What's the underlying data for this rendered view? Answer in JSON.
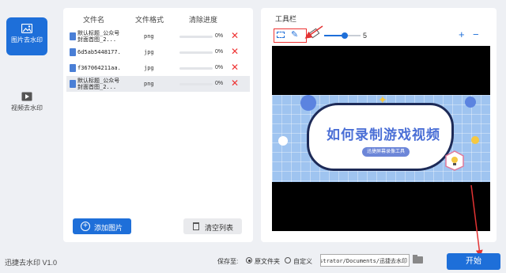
{
  "sidebar": {
    "items": [
      {
        "label": "图片去水印",
        "active": true
      },
      {
        "label": "视频去水印",
        "active": false
      }
    ]
  },
  "file_list": {
    "columns": [
      "文件名",
      "文件格式",
      "清除进度"
    ],
    "rows": [
      {
        "name": "默认标题_公众号封面首图_2...",
        "format": "png",
        "progress": "0%"
      },
      {
        "name": "6d5ab5448177...",
        "format": "jpg",
        "progress": "0%"
      },
      {
        "name": "f367064211aa...",
        "format": "jpg",
        "progress": "0%"
      },
      {
        "name": "默认标题_公众号封面首图_2...",
        "format": "png",
        "progress": "0%"
      }
    ],
    "add_button": "添加图片",
    "clear_button": "清空列表"
  },
  "toolbar": {
    "title": "工具栏",
    "brush_size": "5",
    "zoom_in": "+",
    "zoom_out": "−"
  },
  "preview": {
    "title_text": "如何录制游戏视频",
    "subtitle_text": "迅捷屏幕录像工具"
  },
  "footer": {
    "version": "迅捷去水印 V1.0",
    "save_label": "保存至:",
    "option_original": "原文件夹",
    "option_custom": "自定义",
    "path": "istrator/Documents/迅捷去水印",
    "start_button": "开始"
  },
  "colors": {
    "accent": "#1e6fd9",
    "delete": "#e33333",
    "annotation": "#e33333"
  }
}
